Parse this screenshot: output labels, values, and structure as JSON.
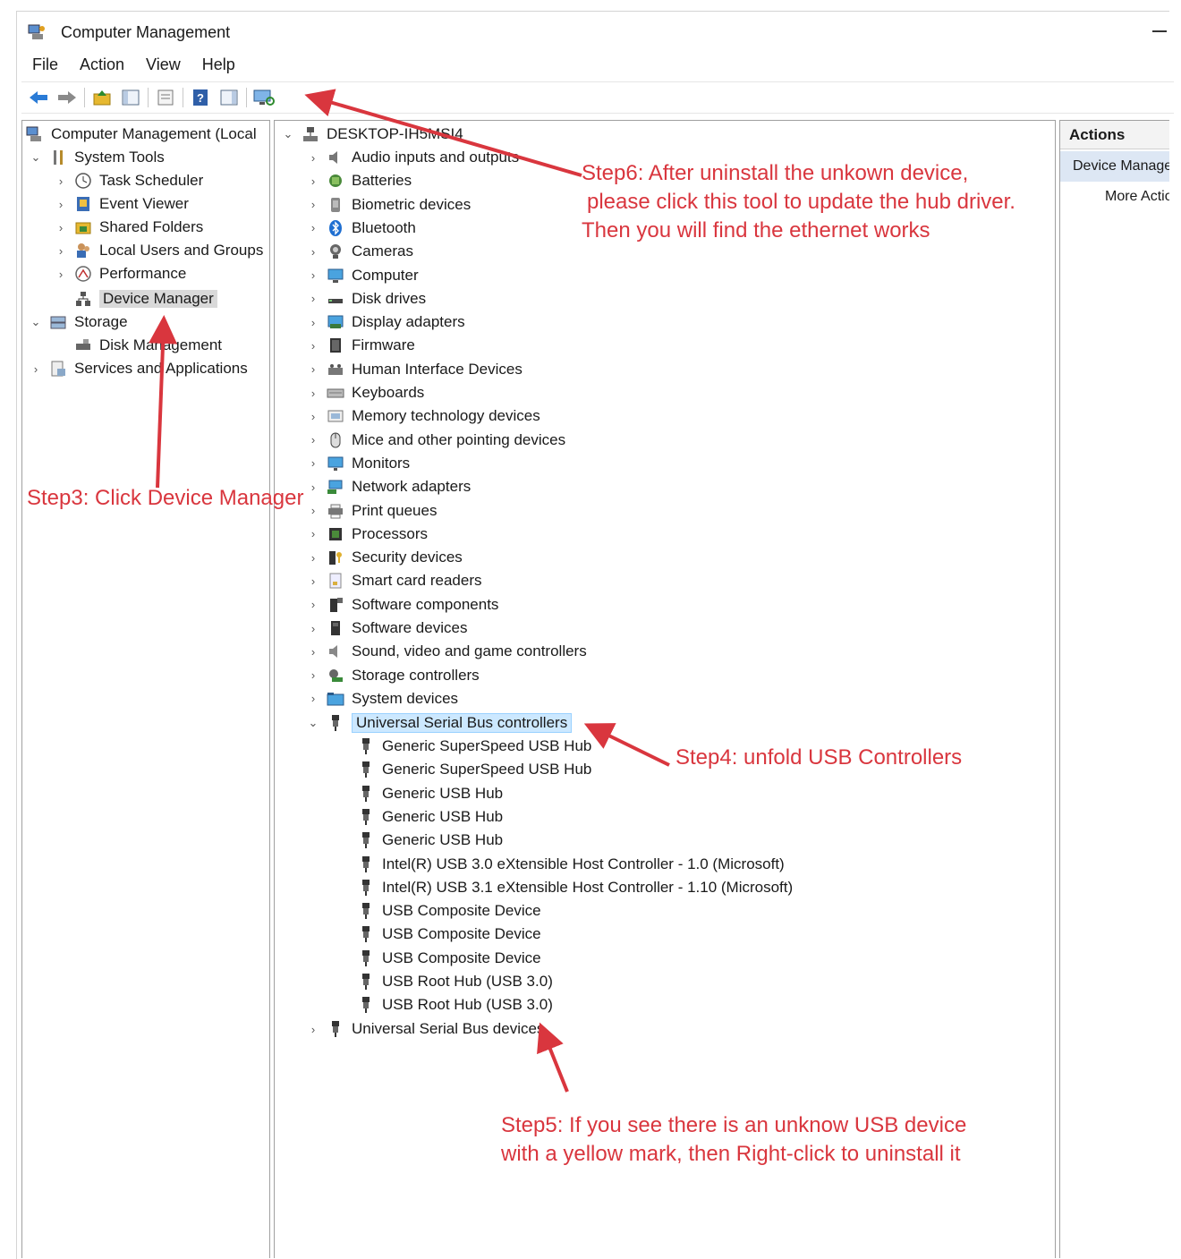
{
  "window": {
    "title": "Computer Management"
  },
  "menu": [
    "File",
    "Action",
    "View",
    "Help"
  ],
  "toolbar": {
    "buttons": [
      "back-arrow-icon",
      "forward-arrow-icon",
      "up-folder-icon",
      "show-hide-console-tree-icon",
      "properties-icon",
      "help-icon",
      "show-hide-action-pane-icon",
      "scan-hardware-changes-icon"
    ]
  },
  "left_tree": {
    "root": "Computer Management (Local",
    "system_tools": "System Tools",
    "task_scheduler": "Task Scheduler",
    "event_viewer": "Event Viewer",
    "shared_folders": "Shared Folders",
    "local_users": "Local Users and Groups",
    "performance": "Performance",
    "device_manager": "Device Manager",
    "storage": "Storage",
    "disk_management": "Disk Management",
    "services": "Services and Applications"
  },
  "device_tree": {
    "root": "DESKTOP-IH5MSI4",
    "categories": [
      "Audio inputs and outputs",
      "Batteries",
      "Biometric devices",
      "Bluetooth",
      "Cameras",
      "Computer",
      "Disk drives",
      "Display adapters",
      "Firmware",
      "Human Interface Devices",
      "Keyboards",
      "Memory technology devices",
      "Mice and other pointing devices",
      "Monitors",
      "Network adapters",
      "Print queues",
      "Processors",
      "Security devices",
      "Smart card readers",
      "Software components",
      "Software devices",
      "Sound, video and game controllers",
      "Storage controllers",
      "System devices"
    ],
    "usb_controllers": "Universal Serial Bus controllers",
    "usb_children": [
      "Generic SuperSpeed USB Hub",
      "Generic SuperSpeed USB Hub",
      "Generic USB Hub",
      "Generic USB Hub",
      "Generic USB Hub",
      "Intel(R) USB 3.0 eXtensible Host Controller - 1.0 (Microsoft)",
      "Intel(R) USB 3.1 eXtensible Host Controller - 1.10 (Microsoft)",
      "USB Composite Device",
      "USB Composite Device",
      "USB Composite Device",
      "USB Root Hub (USB 3.0)",
      "USB Root Hub (USB 3.0)"
    ],
    "usb_devices": "Universal Serial Bus devices"
  },
  "actions": {
    "header": "Actions",
    "device_manager": "Device Manager",
    "more_actions": "More Actions"
  },
  "annotations": {
    "step3": "Step3: Click Device Manager",
    "step4": "Step4: unfold USB Controllers",
    "step5_line1": "Step5: If you see there is an unknow USB device",
    "step5_line2": "with a yellow mark, then Right-click to uninstall it",
    "step6_line1": "Step6: After uninstall the unkown device,",
    "step6_line2": "please click this tool to update the hub driver.",
    "step6_line3": "Then you will find the ethernet works"
  },
  "colors": {
    "annotation": "#d9363e",
    "selection": "#cce8ff",
    "action_selected": "#dde7f4"
  }
}
